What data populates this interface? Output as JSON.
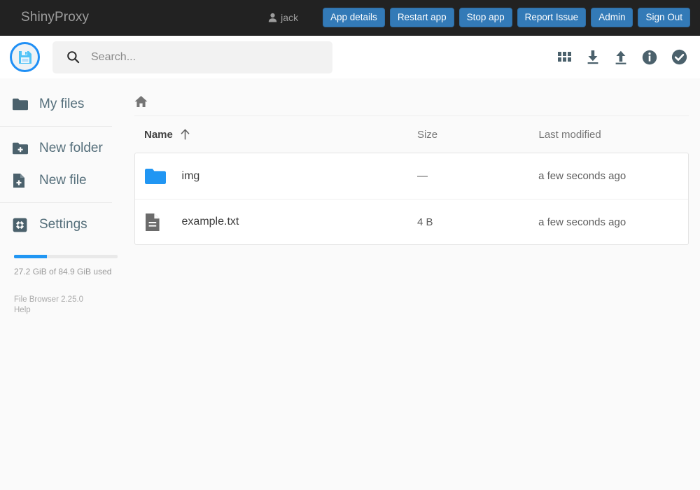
{
  "navbar": {
    "brand": "ShinyProxy",
    "user": "jack",
    "buttons": [
      {
        "label": "App details",
        "name": "app-details-button"
      },
      {
        "label": "Restart app",
        "name": "restart-app-button"
      },
      {
        "label": "Stop app",
        "name": "stop-app-button"
      },
      {
        "label": "Report Issue",
        "name": "report-issue-button"
      },
      {
        "label": "Admin",
        "name": "admin-button"
      },
      {
        "label": "Sign Out",
        "name": "sign-out-button"
      }
    ],
    "background": "#222222",
    "button_color": "#337ab7"
  },
  "filebrowser": {
    "logo_icon": "floppy-disk-save-icon",
    "search": {
      "placeholder": "Search...",
      "value": ""
    },
    "actions": [
      {
        "label": "switch-view",
        "icon": "grid-view-icon"
      },
      {
        "label": "download",
        "icon": "download-icon"
      },
      {
        "label": "upload",
        "icon": "upload-icon"
      },
      {
        "label": "info",
        "icon": "info-circle-icon"
      },
      {
        "label": "select-multiple",
        "icon": "check-circle-icon"
      }
    ]
  },
  "sidebar": {
    "items": [
      {
        "label": "My files",
        "icon": "folder-icon"
      },
      {
        "label": "New folder",
        "icon": "folder-plus-icon"
      },
      {
        "label": "New file",
        "icon": "file-plus-icon"
      },
      {
        "label": "Settings",
        "icon": "gear-icon"
      }
    ],
    "usage": {
      "text": "27.2 GiB of 84.9 GiB used",
      "percent": 32,
      "bar_color": "#2196f3"
    },
    "footer": {
      "version": "File Browser 2.25.0",
      "help": "Help"
    }
  },
  "main": {
    "breadcrumb": {
      "icon": "home-icon",
      "path": ""
    },
    "columns": {
      "name": "Name",
      "size": "Size",
      "modified": "Last modified",
      "sort_indicator": "↑"
    },
    "rows": [
      {
        "name": "img",
        "size": "—",
        "modified": "a few seconds ago",
        "icon": "folder-icon",
        "type": "folder"
      },
      {
        "name": "example.txt",
        "size": "4 B",
        "modified": "a few seconds ago",
        "icon": "file-text-icon",
        "type": "file"
      }
    ]
  }
}
